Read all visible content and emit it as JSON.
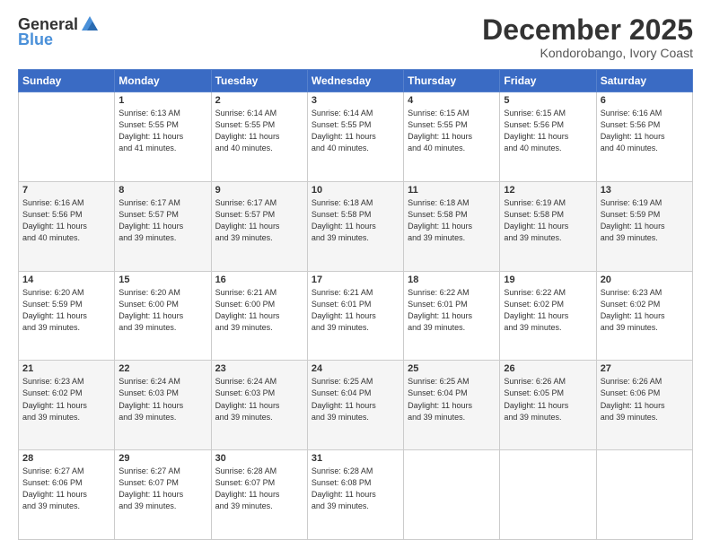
{
  "logo": {
    "general": "General",
    "blue": "Blue"
  },
  "header": {
    "month": "December 2025",
    "location": "Kondorobango, Ivory Coast"
  },
  "weekdays": [
    "Sunday",
    "Monday",
    "Tuesday",
    "Wednesday",
    "Thursday",
    "Friday",
    "Saturday"
  ],
  "weeks": [
    [
      {
        "day": "",
        "info": ""
      },
      {
        "day": "1",
        "info": "Sunrise: 6:13 AM\nSunset: 5:55 PM\nDaylight: 11 hours\nand 41 minutes."
      },
      {
        "day": "2",
        "info": "Sunrise: 6:14 AM\nSunset: 5:55 PM\nDaylight: 11 hours\nand 40 minutes."
      },
      {
        "day": "3",
        "info": "Sunrise: 6:14 AM\nSunset: 5:55 PM\nDaylight: 11 hours\nand 40 minutes."
      },
      {
        "day": "4",
        "info": "Sunrise: 6:15 AM\nSunset: 5:55 PM\nDaylight: 11 hours\nand 40 minutes."
      },
      {
        "day": "5",
        "info": "Sunrise: 6:15 AM\nSunset: 5:56 PM\nDaylight: 11 hours\nand 40 minutes."
      },
      {
        "day": "6",
        "info": "Sunrise: 6:16 AM\nSunset: 5:56 PM\nDaylight: 11 hours\nand 40 minutes."
      }
    ],
    [
      {
        "day": "7",
        "info": "Sunrise: 6:16 AM\nSunset: 5:56 PM\nDaylight: 11 hours\nand 40 minutes."
      },
      {
        "day": "8",
        "info": "Sunrise: 6:17 AM\nSunset: 5:57 PM\nDaylight: 11 hours\nand 39 minutes."
      },
      {
        "day": "9",
        "info": "Sunrise: 6:17 AM\nSunset: 5:57 PM\nDaylight: 11 hours\nand 39 minutes."
      },
      {
        "day": "10",
        "info": "Sunrise: 6:18 AM\nSunset: 5:58 PM\nDaylight: 11 hours\nand 39 minutes."
      },
      {
        "day": "11",
        "info": "Sunrise: 6:18 AM\nSunset: 5:58 PM\nDaylight: 11 hours\nand 39 minutes."
      },
      {
        "day": "12",
        "info": "Sunrise: 6:19 AM\nSunset: 5:58 PM\nDaylight: 11 hours\nand 39 minutes."
      },
      {
        "day": "13",
        "info": "Sunrise: 6:19 AM\nSunset: 5:59 PM\nDaylight: 11 hours\nand 39 minutes."
      }
    ],
    [
      {
        "day": "14",
        "info": "Sunrise: 6:20 AM\nSunset: 5:59 PM\nDaylight: 11 hours\nand 39 minutes."
      },
      {
        "day": "15",
        "info": "Sunrise: 6:20 AM\nSunset: 6:00 PM\nDaylight: 11 hours\nand 39 minutes."
      },
      {
        "day": "16",
        "info": "Sunrise: 6:21 AM\nSunset: 6:00 PM\nDaylight: 11 hours\nand 39 minutes."
      },
      {
        "day": "17",
        "info": "Sunrise: 6:21 AM\nSunset: 6:01 PM\nDaylight: 11 hours\nand 39 minutes."
      },
      {
        "day": "18",
        "info": "Sunrise: 6:22 AM\nSunset: 6:01 PM\nDaylight: 11 hours\nand 39 minutes."
      },
      {
        "day": "19",
        "info": "Sunrise: 6:22 AM\nSunset: 6:02 PM\nDaylight: 11 hours\nand 39 minutes."
      },
      {
        "day": "20",
        "info": "Sunrise: 6:23 AM\nSunset: 6:02 PM\nDaylight: 11 hours\nand 39 minutes."
      }
    ],
    [
      {
        "day": "21",
        "info": "Sunrise: 6:23 AM\nSunset: 6:02 PM\nDaylight: 11 hours\nand 39 minutes."
      },
      {
        "day": "22",
        "info": "Sunrise: 6:24 AM\nSunset: 6:03 PM\nDaylight: 11 hours\nand 39 minutes."
      },
      {
        "day": "23",
        "info": "Sunrise: 6:24 AM\nSunset: 6:03 PM\nDaylight: 11 hours\nand 39 minutes."
      },
      {
        "day": "24",
        "info": "Sunrise: 6:25 AM\nSunset: 6:04 PM\nDaylight: 11 hours\nand 39 minutes."
      },
      {
        "day": "25",
        "info": "Sunrise: 6:25 AM\nSunset: 6:04 PM\nDaylight: 11 hours\nand 39 minutes."
      },
      {
        "day": "26",
        "info": "Sunrise: 6:26 AM\nSunset: 6:05 PM\nDaylight: 11 hours\nand 39 minutes."
      },
      {
        "day": "27",
        "info": "Sunrise: 6:26 AM\nSunset: 6:06 PM\nDaylight: 11 hours\nand 39 minutes."
      }
    ],
    [
      {
        "day": "28",
        "info": "Sunrise: 6:27 AM\nSunset: 6:06 PM\nDaylight: 11 hours\nand 39 minutes."
      },
      {
        "day": "29",
        "info": "Sunrise: 6:27 AM\nSunset: 6:07 PM\nDaylight: 11 hours\nand 39 minutes."
      },
      {
        "day": "30",
        "info": "Sunrise: 6:28 AM\nSunset: 6:07 PM\nDaylight: 11 hours\nand 39 minutes."
      },
      {
        "day": "31",
        "info": "Sunrise: 6:28 AM\nSunset: 6:08 PM\nDaylight: 11 hours\nand 39 minutes."
      },
      {
        "day": "",
        "info": ""
      },
      {
        "day": "",
        "info": ""
      },
      {
        "day": "",
        "info": ""
      }
    ]
  ]
}
